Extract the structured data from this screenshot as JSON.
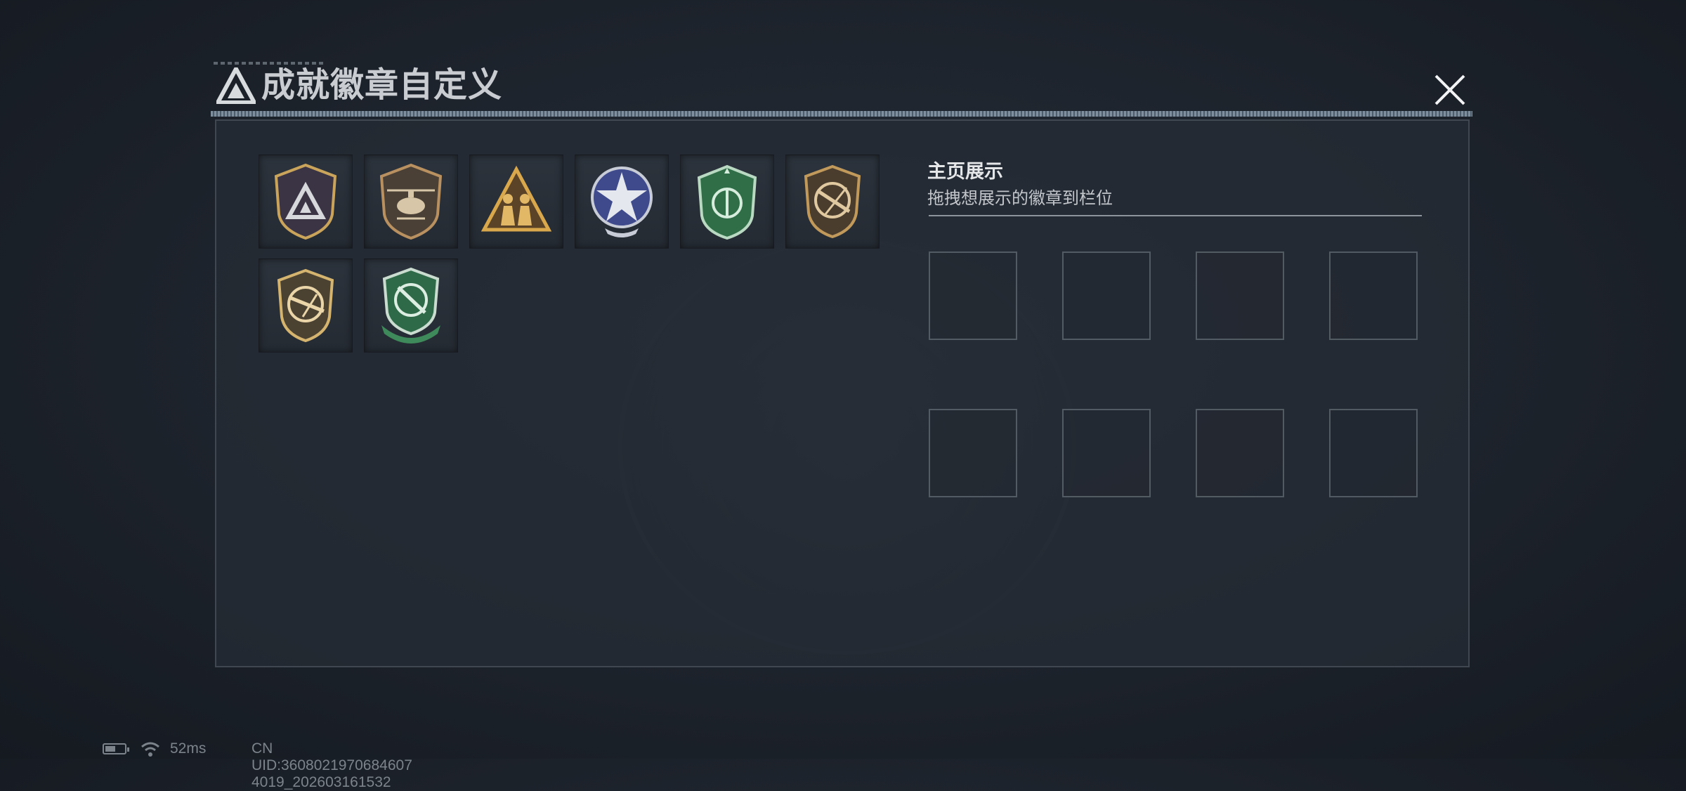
{
  "dialog": {
    "title": "成就徽章自定义"
  },
  "badges": [
    {
      "name": "triangle-shield-badge",
      "style": "purple-gold-triangle"
    },
    {
      "name": "helicopter-badge",
      "style": "bronze-helicopter"
    },
    {
      "name": "soldiers-triangle-badge",
      "style": "gold-soldiers"
    },
    {
      "name": "star-wings-badge",
      "style": "blue-silver-star"
    },
    {
      "name": "green-shield-badge",
      "style": "green-parachute"
    },
    {
      "name": "rifle-badge",
      "style": "bronze-rifle"
    },
    {
      "name": "rifle-badge-2",
      "style": "gold-rifle"
    },
    {
      "name": "knife-badge",
      "style": "green-knife"
    }
  ],
  "showcase": {
    "title": "主页展示",
    "subtitle": "拖拽想展示的徽章到栏位",
    "slot_count": 8
  },
  "status": {
    "latency": "52ms",
    "uid": "CN UID:3608021970684607 4019_202603161532"
  },
  "colors": {
    "panel_bg": "#252c35",
    "gold": "#c9a45a",
    "green": "#3f8a5a",
    "blue": "#5566a8"
  }
}
